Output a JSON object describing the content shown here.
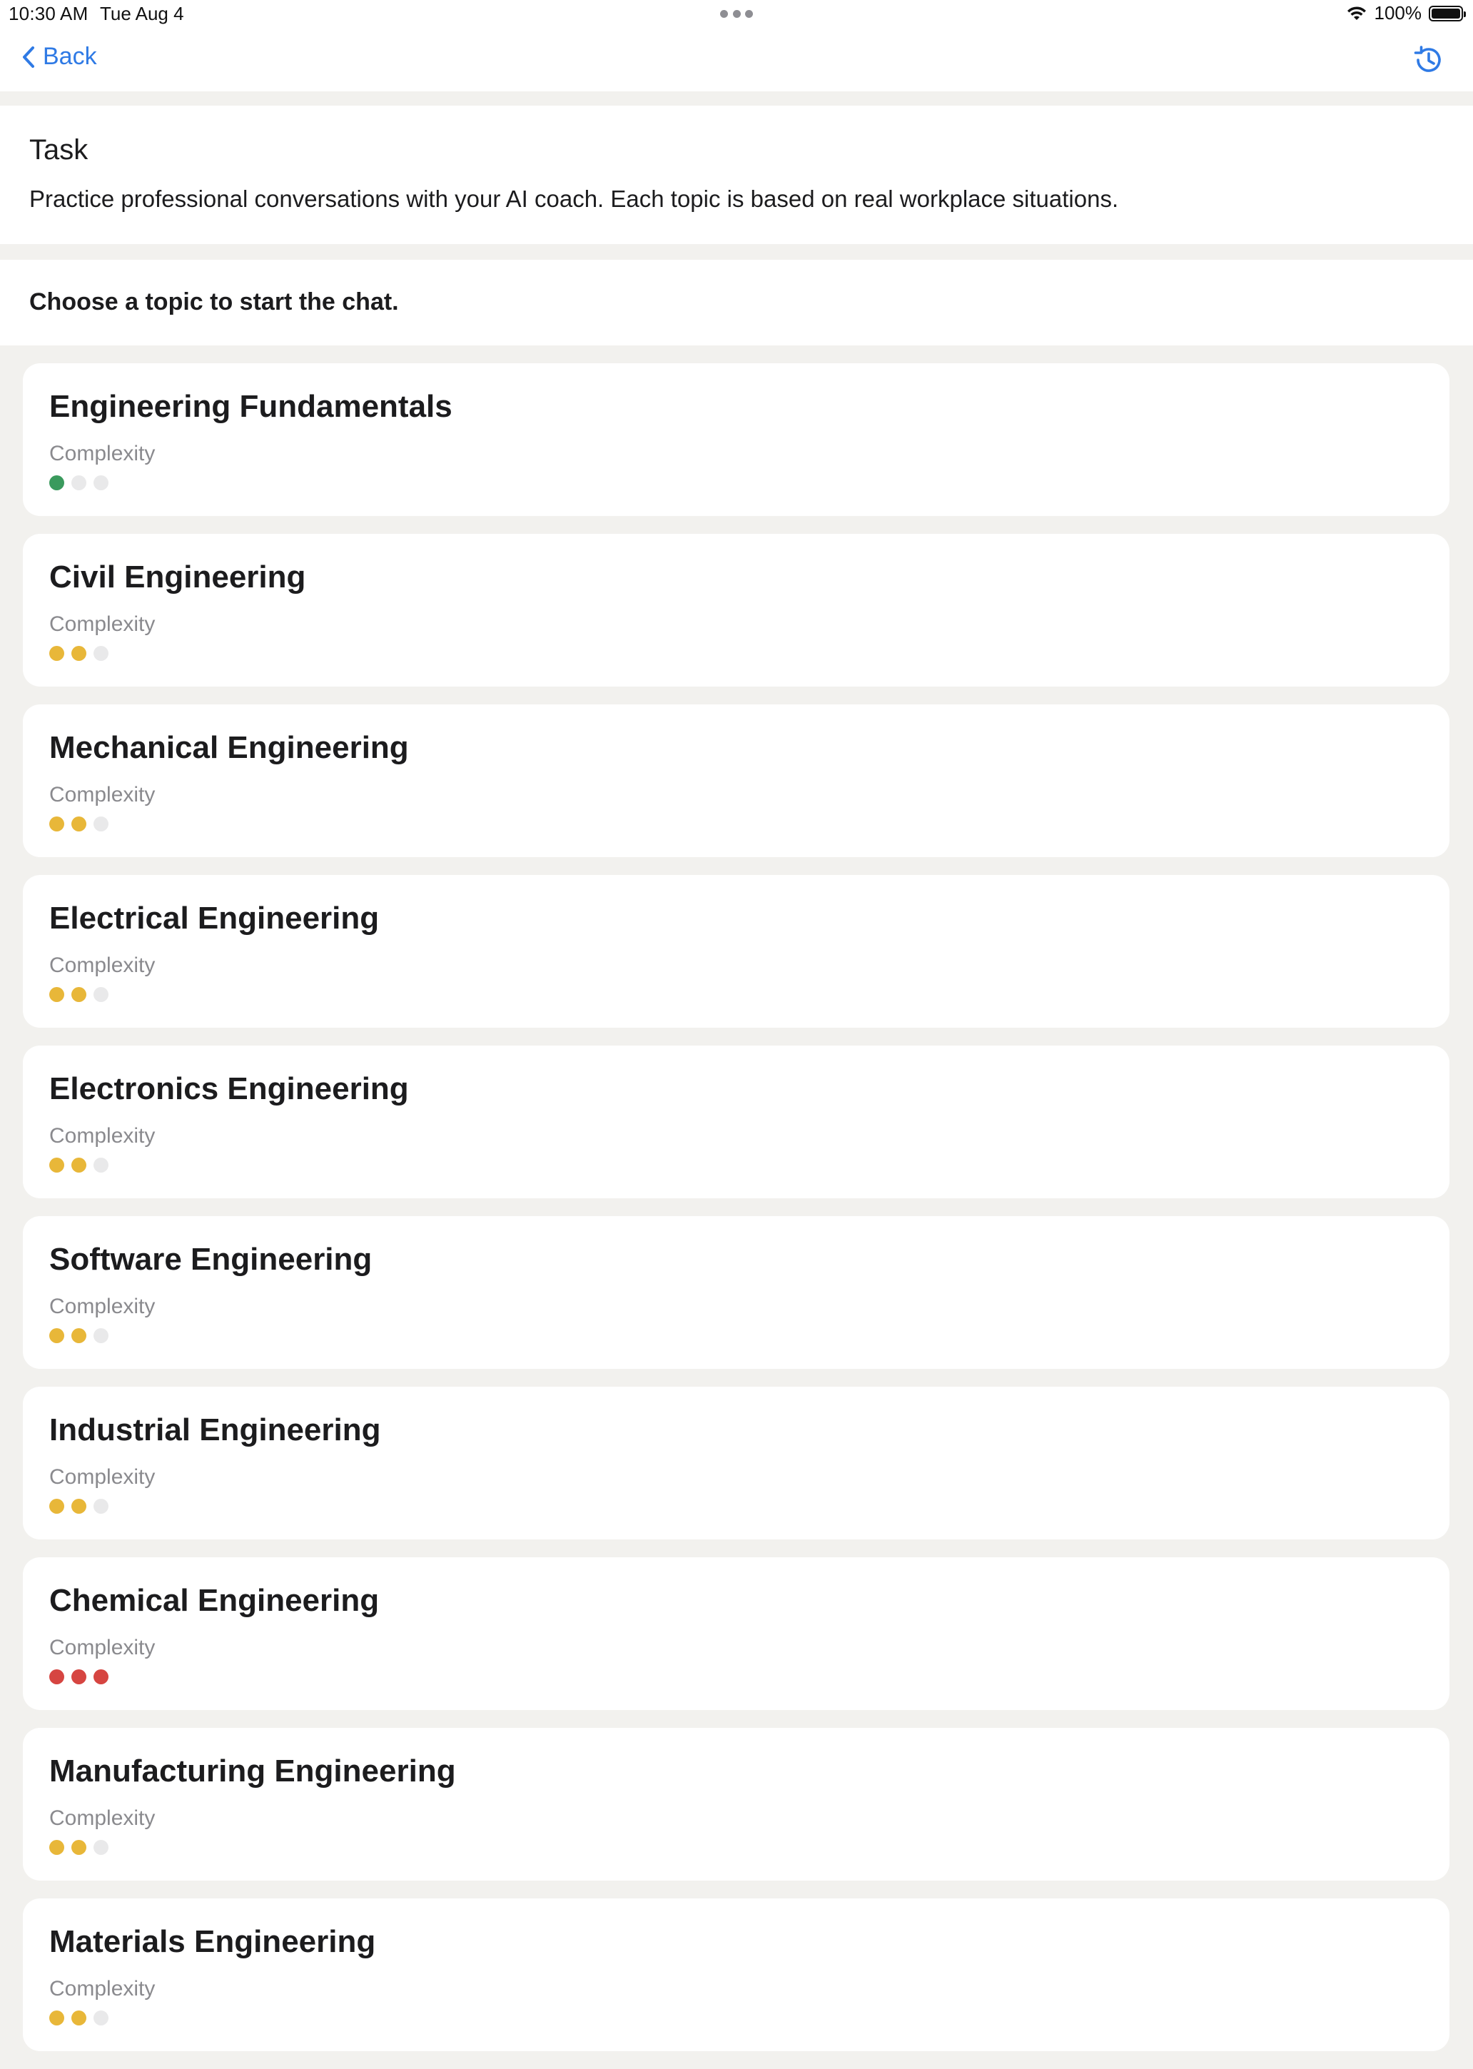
{
  "status_bar": {
    "time": "10:30 AM",
    "date": "Tue Aug 4",
    "battery": "100%"
  },
  "nav": {
    "back_label": "Back"
  },
  "task": {
    "title": "Task",
    "description": "Practice professional conversations with your AI coach. Each topic is based on real workplace situations."
  },
  "prompt": "Choose a topic to start the chat.",
  "complexity_label": "Complexity",
  "colors": {
    "accent": "#2f7ae5",
    "easy": "#3a9a5d",
    "medium": "#e8b739",
    "hard": "#d64541",
    "empty": "#e9e9ea"
  },
  "topics": [
    {
      "title": "Engineering Fundamentals",
      "label": "Complexity",
      "level": 1,
      "color": "#3a9a5d"
    },
    {
      "title": "Civil Engineering",
      "label": "Complexity",
      "level": 2,
      "color": "#e8b739"
    },
    {
      "title": "Mechanical Engineering",
      "label": "Complexity",
      "level": 2,
      "color": "#e8b739"
    },
    {
      "title": "Electrical Engineering",
      "label": "Complexity",
      "level": 2,
      "color": "#e8b739"
    },
    {
      "title": "Electronics Engineering",
      "label": "Complexity",
      "level": 2,
      "color": "#e8b739"
    },
    {
      "title": "Software Engineering",
      "label": "Complexity",
      "level": 2,
      "color": "#e8b739"
    },
    {
      "title": "Industrial Engineering",
      "label": "Complexity",
      "level": 2,
      "color": "#e8b739"
    },
    {
      "title": "Chemical Engineering",
      "label": "Complexity",
      "level": 3,
      "color": "#d64541"
    },
    {
      "title": "Manufacturing Engineering",
      "label": "Complexity",
      "level": 2,
      "color": "#e8b739"
    },
    {
      "title": "Materials Engineering",
      "label": "Complexity",
      "level": 2,
      "color": "#e8b739"
    }
  ]
}
